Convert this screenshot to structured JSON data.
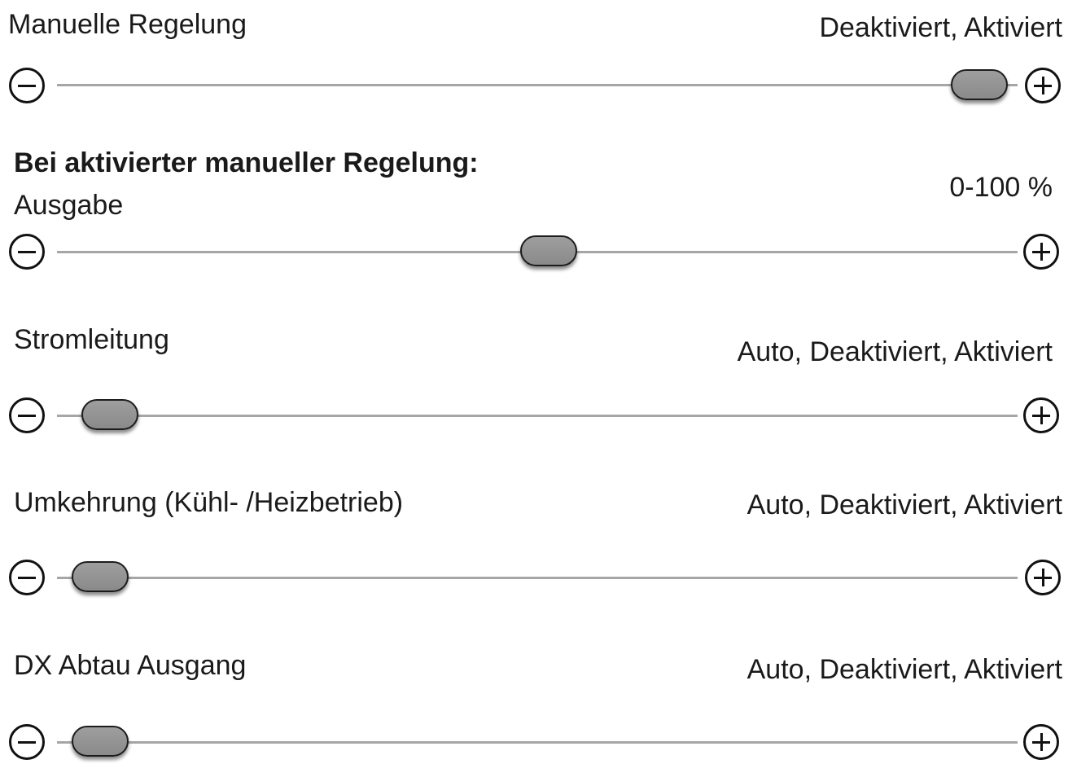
{
  "rows": [
    {
      "label": "Manuelle Regelung",
      "options": "Deaktiviert, Aktiviert",
      "slider_position": 1.0
    },
    {
      "label": "Ausgabe",
      "options": "0-100 %",
      "slider_position": 0.5
    },
    {
      "label": "Stromleitung",
      "options": "Auto, Deaktiviert, Aktiviert",
      "slider_position": 0.0
    },
    {
      "label": "Umkehrung (Kühl- /Heizbetrieb)",
      "options": "Auto, Deaktiviert, Aktiviert",
      "slider_position": 0.0
    },
    {
      "label": "DX Abtau Ausgang",
      "options": "Auto, Deaktiviert, Aktiviert",
      "slider_position": 0.0
    }
  ],
  "section_heading": "Bei aktivierter manueller Regelung:"
}
